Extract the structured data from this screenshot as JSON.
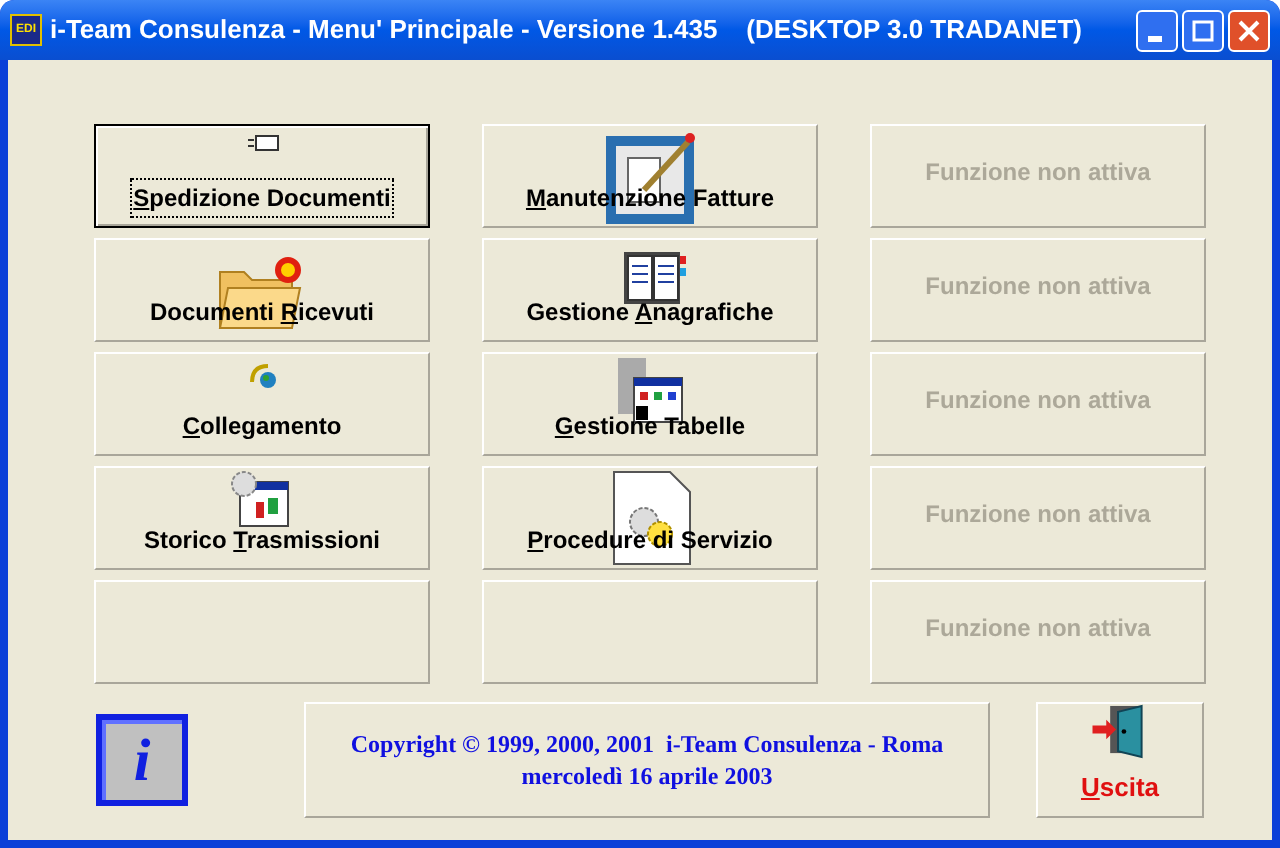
{
  "window": {
    "title": "i-Team Consulenza - Menu' Principale - Versione 1.435    (DESKTOP 3.0 TRADANET)",
    "app_icon_text": "EDI"
  },
  "menu_buttons": [
    {
      "kind": "command",
      "label_parts": [
        {
          "text": "S",
          "underlined": true
        },
        {
          "text": "pedizione Documenti",
          "underlined": false
        }
      ],
      "focused": true,
      "disabled": false
    },
    {
      "kind": "command",
      "label_parts": [
        {
          "text": "M",
          "underlined": true
        },
        {
          "text": "anutenzione Fatture",
          "underlined": false
        }
      ],
      "focused": false,
      "disabled": false
    },
    {
      "kind": "command",
      "label_parts": [
        {
          "text": "Funzione non attiva",
          "underlined": false
        }
      ],
      "focused": false,
      "disabled": true
    },
    {
      "kind": "command",
      "label_parts": [
        {
          "text": "Documenti ",
          "underlined": false
        },
        {
          "text": "R",
          "underlined": true
        },
        {
          "text": "icevuti",
          "underlined": false
        }
      ],
      "focused": false,
      "disabled": false
    },
    {
      "kind": "command",
      "label_parts": [
        {
          "text": "Gestione ",
          "underlined": false
        },
        {
          "text": "A",
          "underlined": true
        },
        {
          "text": "nagrafiche",
          "underlined": false
        }
      ],
      "focused": false,
      "disabled": false
    },
    {
      "kind": "command",
      "label_parts": [
        {
          "text": "Funzione non attiva",
          "underlined": false
        }
      ],
      "focused": false,
      "disabled": true
    },
    {
      "kind": "command",
      "label_parts": [
        {
          "text": "C",
          "underlined": true
        },
        {
          "text": "ollegamento",
          "underlined": false
        }
      ],
      "focused": false,
      "disabled": false
    },
    {
      "kind": "command",
      "label_parts": [
        {
          "text": "G",
          "underlined": true
        },
        {
          "text": "estione Tabelle",
          "underlined": false
        }
      ],
      "focused": false,
      "disabled": false
    },
    {
      "kind": "command",
      "label_parts": [
        {
          "text": "Funzione non attiva",
          "underlined": false
        }
      ],
      "focused": false,
      "disabled": true
    },
    {
      "kind": "command",
      "label_parts": [
        {
          "text": "Storico ",
          "underlined": false
        },
        {
          "text": "T",
          "underlined": true
        },
        {
          "text": "rasmissioni",
          "underlined": false
        }
      ],
      "focused": false,
      "disabled": false
    },
    {
      "kind": "command",
      "label_parts": [
        {
          "text": "P",
          "underlined": true
        },
        {
          "text": "rocedure di Servizio",
          "underlined": false
        }
      ],
      "focused": false,
      "disabled": false
    },
    {
      "kind": "command",
      "label_parts": [
        {
          "text": "Funzione non attiva",
          "underlined": false
        }
      ],
      "focused": false,
      "disabled": true
    },
    {
      "kind": "empty"
    },
    {
      "kind": "empty"
    },
    {
      "kind": "command",
      "label_parts": [
        {
          "text": "Funzione non attiva",
          "underlined": false
        }
      ],
      "focused": false,
      "disabled": true
    }
  ],
  "copyright": [
    "Copyright © 1999, 2000, 2001  i-Team Consulenza - Roma",
    "mercoledì 16 aprile 2003"
  ],
  "info_button": {
    "label": "i"
  },
  "exit_button": {
    "label_parts": [
      {
        "text": "U",
        "underlined": true
      },
      {
        "text": "scita",
        "underlined": false
      }
    ]
  }
}
